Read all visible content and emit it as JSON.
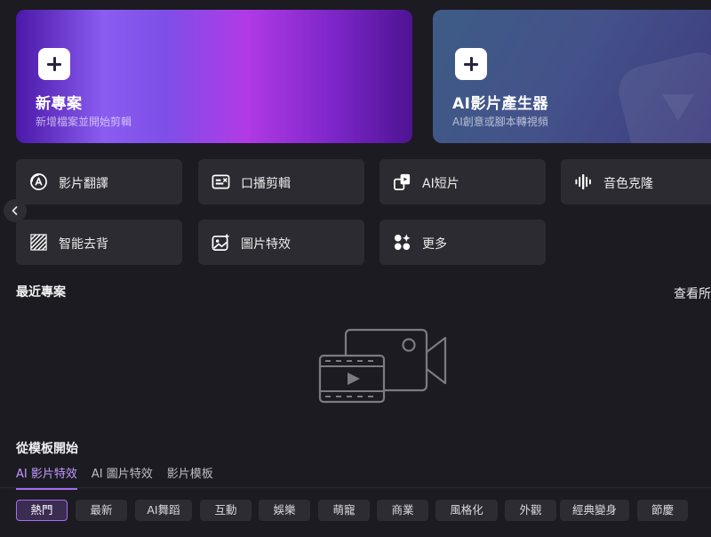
{
  "hero": {
    "new_project": {
      "title": "新專案",
      "subtitle": "新增檔案並開始剪輯"
    },
    "ai_video": {
      "title": "AI影片產生器",
      "subtitle": "AI創意或腳本轉視頻"
    }
  },
  "tools": [
    {
      "label": "影片翻譯",
      "icon": "translate-icon"
    },
    {
      "label": "口播剪輯",
      "icon": "speech-edit-icon"
    },
    {
      "label": "AI短片",
      "icon": "ai-short-icon"
    },
    {
      "label": "音色克隆",
      "icon": "voice-clone-icon"
    },
    {
      "label": "智能去背",
      "icon": "remove-bg-icon"
    },
    {
      "label": "圖片特效",
      "icon": "image-effect-icon"
    },
    {
      "label": "更多",
      "icon": "more-apps-icon"
    }
  ],
  "recent": {
    "title": "最近專案",
    "see_all": "查看所"
  },
  "templates": {
    "title": "從模板開始",
    "tabs": [
      "AI 影片特效",
      "AI 圖片特效",
      "影片模板"
    ],
    "active_tab": "AI 影片特效",
    "chips": [
      "熱門",
      "最新",
      "AI舞蹈",
      "互動",
      "娛樂",
      "萌寵",
      "商業",
      "風格化",
      "外觀",
      "經典變身",
      "節慶"
    ],
    "active_chip": "熱門"
  },
  "colors": {
    "accent": "#a36cf2",
    "background": "#1c1b22",
    "card": "#2c2b31"
  }
}
